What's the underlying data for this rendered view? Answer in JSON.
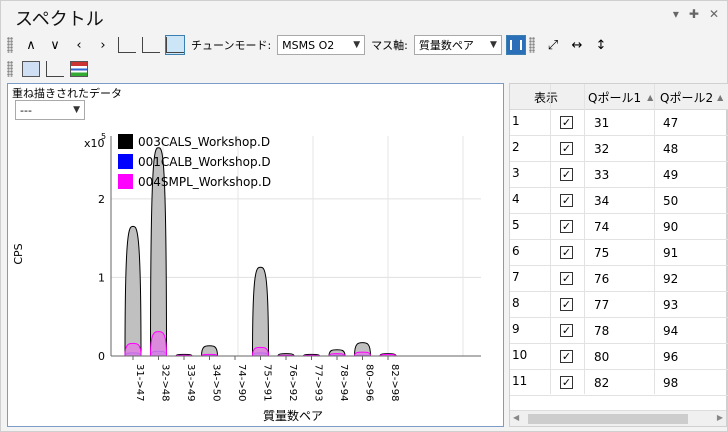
{
  "window": {
    "title": "スペクトル",
    "controls": [
      "▾",
      "✚",
      "✕"
    ]
  },
  "toolbar1": {
    "tune_mode_label": "チューンモード:",
    "tune_mode_value": "MSMS O2",
    "mass_axis_label": "マス軸:",
    "mass_axis_value": "質量数ペア"
  },
  "overlay": {
    "label": "重ね描きされたデータ",
    "value": "---"
  },
  "chart_data": {
    "type": "area",
    "ylabel": "CPS",
    "xlabel": "質量数ペア",
    "y_multiplier": "x10",
    "y_exponent": "5",
    "ylim": [
      0,
      2.8
    ],
    "yticks": [
      "0",
      "1",
      "2"
    ],
    "categories": [
      "31->47",
      "32->48",
      "33->49",
      "34->50",
      "74->90",
      "75->91",
      "76->92",
      "77->93",
      "78->94",
      "80->96",
      "82->98"
    ],
    "series": [
      {
        "name": "003CALS_Workshop.D",
        "values": [
          1.65,
          2.65,
          0.02,
          0.13,
          0.0,
          1.13,
          0.03,
          0.02,
          0.08,
          0.17,
          0.03
        ],
        "color": "#000000"
      },
      {
        "name": "001CALB_Workshop.D",
        "values": [
          0.04,
          0.06,
          0.0,
          0.01,
          0.0,
          0.04,
          0.0,
          0.0,
          0.01,
          0.01,
          0.0
        ],
        "color": "#0000ff"
      },
      {
        "name": "004SMPL_Workshop.D",
        "values": [
          0.16,
          0.31,
          0.01,
          0.02,
          0.0,
          0.11,
          0.01,
          0.01,
          0.03,
          0.05,
          0.02
        ],
        "color": "#ff00ff"
      }
    ],
    "legend": "top-left",
    "grid": true
  },
  "table": {
    "headers": {
      "show": "表示",
      "q1": "Qポール1",
      "q2": "Qポール2"
    },
    "rows": [
      {
        "n": "1",
        "q1": "31",
        "q2": "47"
      },
      {
        "n": "2",
        "q1": "32",
        "q2": "48"
      },
      {
        "n": "3",
        "q1": "33",
        "q2": "49"
      },
      {
        "n": "4",
        "q1": "34",
        "q2": "50"
      },
      {
        "n": "5",
        "q1": "74",
        "q2": "90"
      },
      {
        "n": "6",
        "q1": "75",
        "q2": "91"
      },
      {
        "n": "7",
        "q1": "76",
        "q2": "92"
      },
      {
        "n": "8",
        "q1": "77",
        "q2": "93"
      },
      {
        "n": "9",
        "q1": "78",
        "q2": "94"
      },
      {
        "n": "10",
        "q1": "80",
        "q2": "96"
      },
      {
        "n": "11",
        "q1": "82",
        "q2": "98"
      }
    ],
    "check_mark": "✓"
  }
}
